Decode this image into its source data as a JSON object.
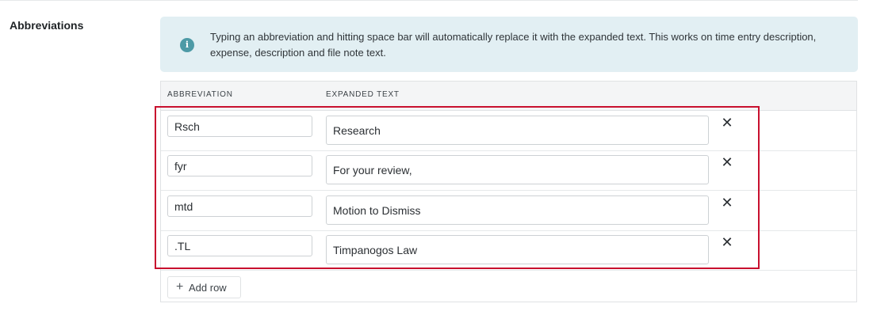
{
  "section": {
    "title": "Abbreviations"
  },
  "info": {
    "icon": "info-icon",
    "icon_glyph": "i",
    "text": "Typing an abbreviation and hitting space bar will automatically replace it with the expanded text. This works on time entry description, expense, description and file note text."
  },
  "table": {
    "headers": {
      "abbreviation": "ABBREVIATION",
      "expanded": "EXPANDED TEXT"
    },
    "rows": [
      {
        "abbreviation": "Rsch",
        "expanded": "Research"
      },
      {
        "abbreviation": "fyr",
        "expanded": "For your review,"
      },
      {
        "abbreviation": "mtd",
        "expanded": "Motion to Dismiss"
      },
      {
        "abbreviation": ".TL",
        "expanded": "Timpanogos Law"
      }
    ],
    "remove_glyph": "✕",
    "add_row": {
      "plus": "+",
      "label": "Add row"
    }
  },
  "colors": {
    "highlight": "#c8102e",
    "info_bg": "#e2eff3",
    "info_icon": "#4d9aa6"
  }
}
